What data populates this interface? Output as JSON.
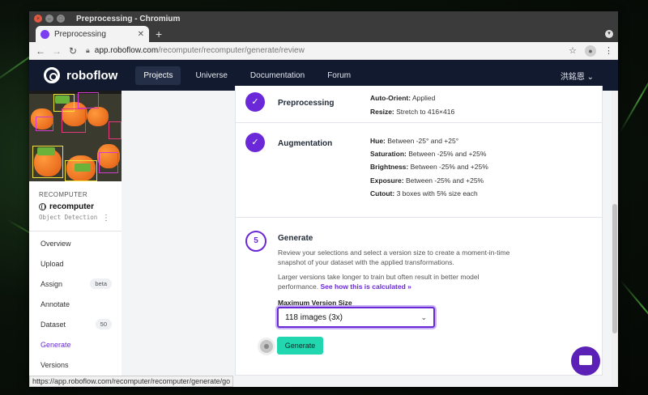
{
  "window": {
    "title": "Preprocessing - Chromium"
  },
  "browser": {
    "tab_title": "Preprocessing",
    "url_host": "app.roboflow.com",
    "url_path": "/recomputer/recomputer/generate/review",
    "status_url": "https://app.roboflow.com/recomputer/recomputer/generate/go"
  },
  "nav": {
    "logo": "roboflow",
    "links": [
      "Projects",
      "Universe",
      "Documentation",
      "Forum"
    ],
    "user": "洪銘恩"
  },
  "sidebar": {
    "project_label": "RECOMPUTER",
    "project_name": "recomputer",
    "project_type": "Object Detection",
    "items": [
      {
        "label": "Overview"
      },
      {
        "label": "Upload"
      },
      {
        "label": "Assign",
        "badge": "beta"
      },
      {
        "label": "Annotate"
      },
      {
        "label": "Dataset",
        "badge": "50"
      },
      {
        "label": "Generate"
      },
      {
        "label": "Versions"
      }
    ]
  },
  "preprocessing": {
    "title": "Preprocessing",
    "rows": [
      {
        "key": "Auto-Orient:",
        "value": "Applied"
      },
      {
        "key": "Resize:",
        "value": "Stretch to 416×416"
      }
    ]
  },
  "augmentation": {
    "title": "Augmentation",
    "rows": [
      {
        "key": "Hue:",
        "value": "Between -25° and +25°"
      },
      {
        "key": "Saturation:",
        "value": "Between -25% and +25%"
      },
      {
        "key": "Brightness:",
        "value": "Between -25% and +25%"
      },
      {
        "key": "Exposure:",
        "value": "Between -25% and +25%"
      },
      {
        "key": "Cutout:",
        "value": "3 boxes with 5% size each"
      }
    ]
  },
  "generate": {
    "step": "5",
    "title": "Generate",
    "desc1": "Review your selections and select a version size to create a moment-in-time snapshot of your dataset with the applied transformations.",
    "desc2": "Larger versions take longer to train but often result in better model performance.",
    "link": "See how this is calculated »",
    "field_label": "Maximum Version Size",
    "select_value": "118 images (3x)",
    "button": "Generate"
  },
  "colors": {
    "accent": "#6a28d8",
    "nav_bg": "#111a2e",
    "generate_btn": "#20d7b0"
  }
}
